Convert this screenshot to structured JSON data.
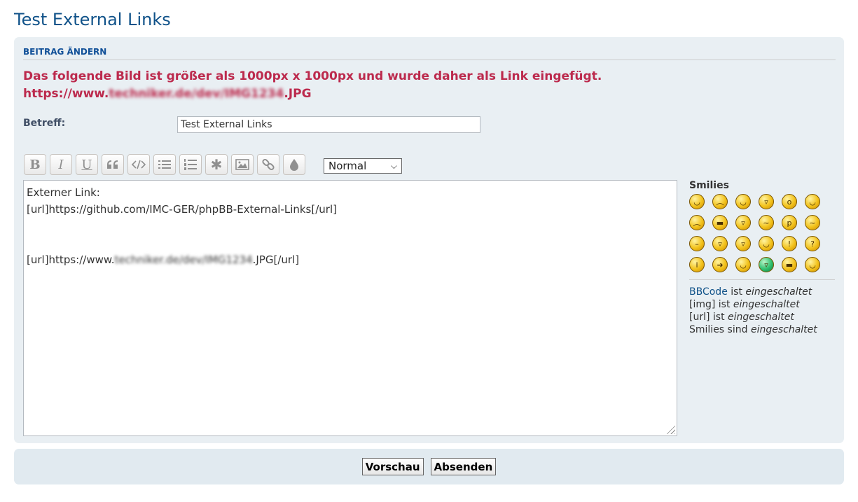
{
  "page": {
    "title": "Test External Links"
  },
  "panel": {
    "heading": "BEITRAG ÄNDERN",
    "error_line1": "Das folgende Bild ist größer als 1000px x 1000px und wurde daher als Link eingefügt.",
    "error_line2_prefix": "https://www.",
    "error_line2_blurred": "techniker.de/dev/IMG1234",
    "error_line2_suffix": ".JPG"
  },
  "subject": {
    "label": "Betreff:",
    "value": "Test External Links"
  },
  "toolbar": {
    "buttons": [
      "bold",
      "italic",
      "underline",
      "quote",
      "code",
      "list",
      "numbered-list",
      "list-item",
      "image",
      "link",
      "color"
    ],
    "font_size_value": "Normal"
  },
  "editor": {
    "line1": "Externer Link:",
    "line2": "[url]https://github.com/IMC-GER/phpBB-External-Links[/url]",
    "line3_prefix": "[url]https://www.",
    "line3_blurred": "techniker.de/dev/IMG1234",
    "line3_suffix": ".JPG[/url]"
  },
  "smilies": {
    "title": "Smilies",
    "icons": [
      "smile-icon",
      "sad-icon",
      "wink-icon",
      "grin-icon",
      "surprised-icon",
      "glasses-icon",
      "cry-icon",
      "cool-icon",
      "laugh-icon",
      "mad-icon",
      "tongue-icon",
      "confused-icon",
      "neutral-icon",
      "evil-icon",
      "twisted-icon",
      "rolleyes-icon",
      "exclamation-icon",
      "question-icon",
      "idea-icon",
      "arrow-icon",
      "geek-icon",
      "green-grin-icon",
      "ugeek-icon",
      "nerd-icon"
    ]
  },
  "status": {
    "bbcode_link": "BBCode",
    "bbcode_rest": " ist ",
    "bbcode_state": "eingeschaltet",
    "img_label": "[img] ist ",
    "img_state": "eingeschaltet",
    "url_label": "[url] ist ",
    "url_state": "eingeschaltet",
    "smilies_label": "Smilies sind ",
    "smilies_state": "eingeschaltet"
  },
  "submit": {
    "preview": "Vorschau",
    "send": "Absenden"
  }
}
